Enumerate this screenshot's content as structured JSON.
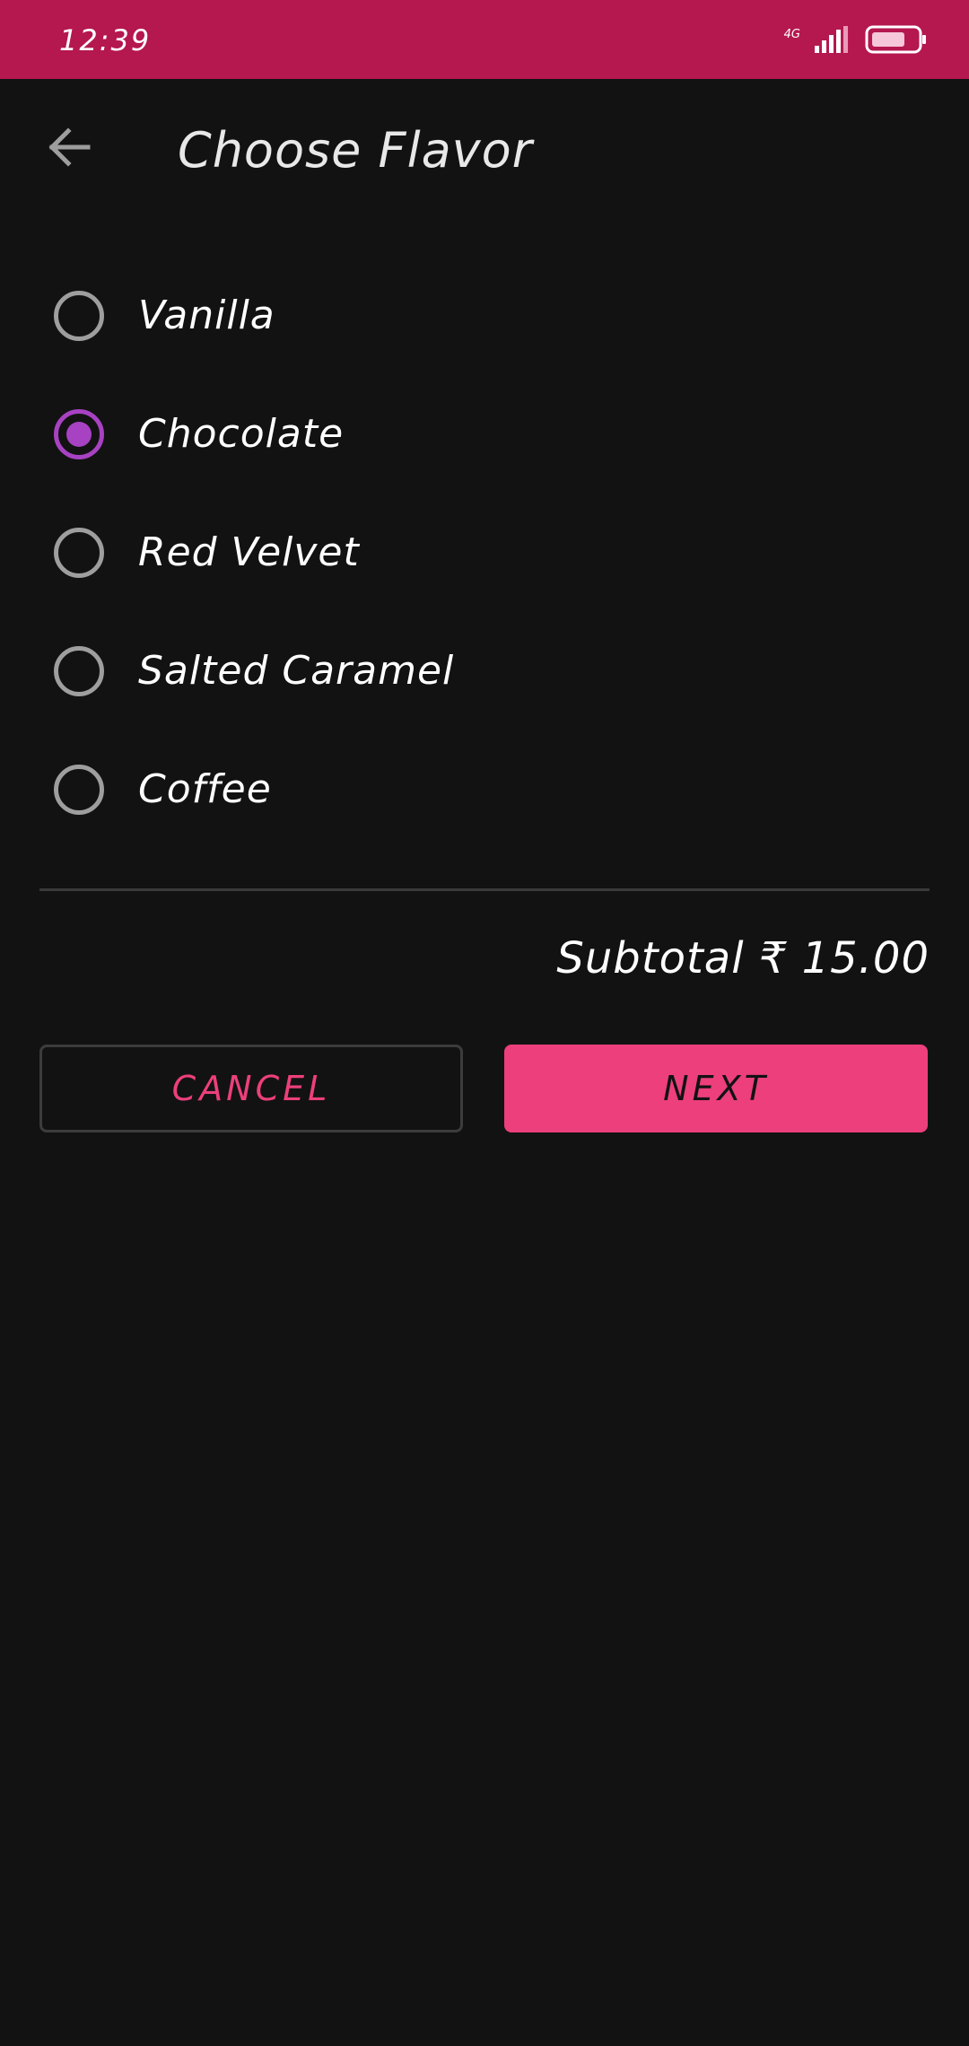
{
  "status_bar": {
    "time": "12:39",
    "network": "4G",
    "signal_bars": 4,
    "battery_level": 0.75,
    "background_color": "#b5174f"
  },
  "app_bar": {
    "back_icon": "arrow-back-icon",
    "title": "Choose Flavor"
  },
  "options": [
    {
      "label": "Vanilla",
      "selected": false
    },
    {
      "label": "Chocolate",
      "selected": true
    },
    {
      "label": "Red Velvet",
      "selected": false
    },
    {
      "label": "Salted Caramel",
      "selected": false
    },
    {
      "label": "Coffee",
      "selected": false
    }
  ],
  "summary": {
    "subtotal": "Subtotal ₹ 15.00"
  },
  "actions": {
    "cancel_label": "CANCEL",
    "next_label": "NEXT"
  },
  "colors": {
    "background": "#121212",
    "accent": "#ec3f7b",
    "radio_selected": "#a742c2",
    "radio_unselected": "#9e9e9e"
  }
}
